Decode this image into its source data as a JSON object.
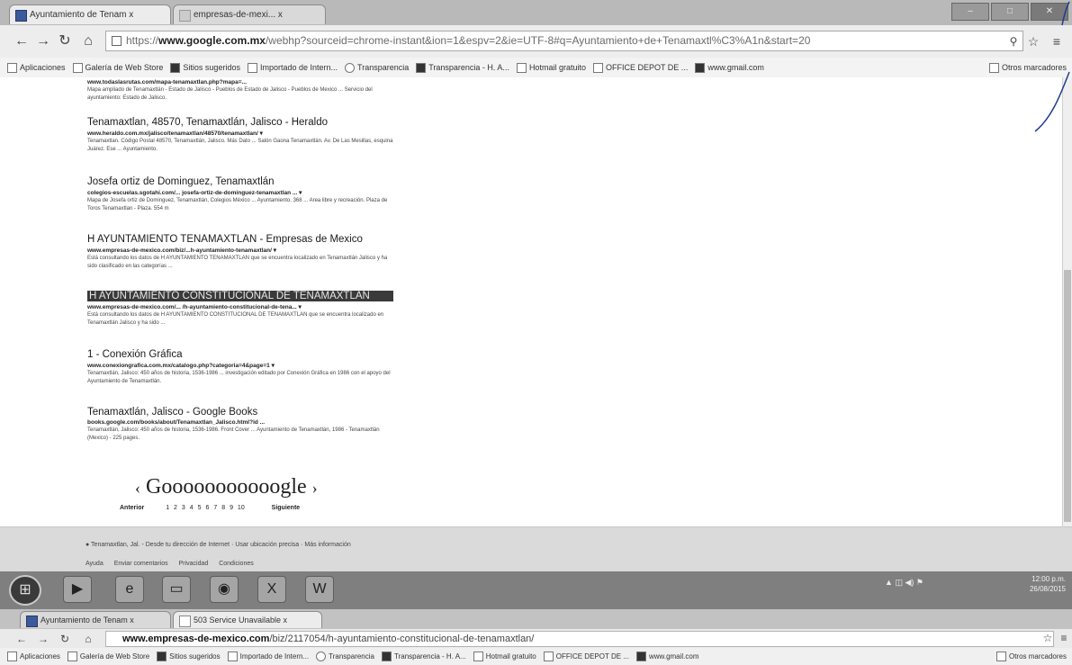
{
  "browser": {
    "tabs": [
      {
        "label": "Ayuntamiento de Tenam x"
      },
      {
        "label": "empresas-de-mexi... x"
      }
    ],
    "url": {
      "scheme": "https://",
      "host": "www.google.com.mx",
      "path": "/webhp?sourceid=chrome-instant&ion=1&espv=2&ie=UTF-8#q=Ayuntamiento+de+Tenamaxtl%C3%A1n&start=20"
    },
    "bookmarks": [
      "Aplicaciones",
      "Galería de Web Store",
      "Sitios sugeridos",
      "Importado de Intern...",
      "Transparencia",
      "Transparencia - H. A...",
      "Hotmail gratuito",
      "OFFICE DEPOT DE ...",
      "www.gmail.com",
      "Otros marcadores"
    ]
  },
  "results": [
    {
      "title": "",
      "url": "www.todaslasrutas.com/mapa-tenamaxtlan.php?mapa=...",
      "desc": "Mapa ampliado de Tenamaxtlán - Estado de Jalisco - Pueblos de Estado de Jalisco - Pueblos de Mexico ... Servicio del ayuntamiento: Estado de Jalisco."
    },
    {
      "title": "Tenamaxtlan, 48570, Tenamaxtlán, Jalisco - Heraldo",
      "url": "www.heraldo.com.mx/jalisco/tenamaxtlan/48570/tenamaxtlan/ ▾",
      "desc": "Tenamaxtlan. Código Postal 48570, Tenamaxtlán, Jalisco. Más Dato ... Salón Gaona Tenamaxtlán. Av. De Las Mesillas, esquina Juárez. Ese ... Ayuntamiento."
    },
    {
      "title": "Josefa ortiz de Dominguez, Tenamaxtlán",
      "url": "colegios-escuelas.sgotahi.com/... josefa-ortiz-de-dominguez-tenamaxtlan ... ▾",
      "desc": "Mapa de Josefa ortiz de Dominguez, Tenamaxtlán, Colegios México ... Ayuntamiento. 368 ... Area libre y recreación. Plaza de Toros Tenamaxtlan - Plaza. 554 m"
    },
    {
      "title": "H AYUNTAMIENTO TENAMAXTLAN - Empresas de Mexico",
      "url": "www.empresas-de-mexico.com/biz/...h-ayuntamiento-tenamaxtlan/ ▾",
      "desc": "Está consultando los datos de H AYUNTAMIENTO TENAMAXTLAN que se encuentra localizado en Tenamaxtlán Jalisco y ha sido clasificado en las categorías ..."
    },
    {
      "title": "H AYUNTAMIENTO CONSTITUCIONAL DE TENAMAXTLAN",
      "url": "www.empresas-de-mexico.com/... /h-ayuntamiento-constitucional-de-tena... ▾",
      "desc": "Está consultando los datos de H AYUNTAMIENTO CONSTITUCIONAL DE TENAMAXTLAN que se encuentra localizado en Tenamaxtlán Jalisco y ha sido ..."
    },
    {
      "title": "1 - Conexión Gráfica",
      "url": "www.conexiongrafica.com.mx/catalogo.php?categoria=4&page=1 ▾",
      "desc": "Tenamaxtlán, Jalisco: 450 años de historia, 1536-1986 ... investigación editado por Conexión Gráfica en 1986 con el apoyo del Ayuntamiento de Tenamaxtlán."
    },
    {
      "title": "Tenamaxtlán, Jalisco - Google Books",
      "url": "books.google.com/books/about/Tenamaxtlan_Jalisco.html?id ...",
      "desc": "Tenamaxtlán, Jalisco: 450 años de historia, 1536-1986. Front Cover ... Ayuntamiento de Tenamaxtlán, 1986 - Tenamaxtlán (Mexico) - 225 pages."
    }
  ],
  "pager": {
    "prev": "‹",
    "logo": "Gooooooooooogle",
    "next": "›",
    "prev_label": "Anterior",
    "next_label": "Siguiente",
    "pages": [
      "1",
      "2",
      "3",
      "4",
      "5",
      "6",
      "7",
      "8",
      "9",
      "10"
    ]
  },
  "footer": {
    "line1": "● Tenamaxtlan, Jal. - Desde tu dirección de Internet · Usar ubicación precisa · Más información",
    "links": [
      "Ayuda",
      "Enviar comentarios",
      "Privacidad",
      "Condiciones"
    ]
  },
  "taskbar": {
    "clock_time": "12:00 p.m.",
    "clock_date": "26/08/2015"
  },
  "browser2": {
    "tabs": [
      {
        "label": "Ayuntamiento de Tenam x"
      },
      {
        "label": "503 Service Unavailable x"
      }
    ],
    "url": {
      "host": "www.empresas-de-mexico.com",
      "path": "/biz/2117054/h-ayuntamiento-constitucional-de-tenamaxtlan/"
    },
    "bookmarks": [
      "Aplicaciones",
      "Galería de Web Store",
      "Sitios sugeridos",
      "Importado de Intern...",
      "Transparencia",
      "Transparencia - H. A...",
      "Hotmail gratuito",
      "OFFICE DEPOT DE ...",
      "www.gmail.com",
      "Otros marcadores"
    ]
  }
}
